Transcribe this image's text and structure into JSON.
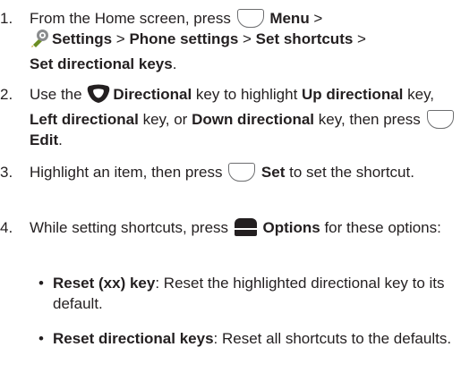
{
  "steps": [
    {
      "number": "1.",
      "parts": {
        "a": "From the Home screen, press ",
        "menu": "Menu",
        "gt1": " > ",
        "settings": "Settings",
        "gt2": " > ",
        "phone_settings": "Phone settings",
        "gt3": " > ",
        "set_shortcuts": "Set shortcuts",
        "gt4": " > ",
        "set_directional_keys": "Set directional keys",
        "end": "."
      }
    },
    {
      "number": "2.",
      "parts": {
        "a": "Use the ",
        "directional": "Directional",
        "b": " key to highlight ",
        "up": "Up directional",
        "c": " key, ",
        "left": "Left directional",
        "d": " key, or ",
        "down": "Down directional",
        "e": " key, then press ",
        "edit": "Edit",
        "end": "."
      }
    },
    {
      "number": "3.",
      "parts": {
        "a": "Highlight an item, then press ",
        "set": "Set",
        "b": " to set the shortcut."
      }
    },
    {
      "number": "4.",
      "parts": {
        "a": "While setting shortcuts, press ",
        "options": "Options",
        "b": " for these options:"
      }
    }
  ],
  "bullets": [
    {
      "marker": "•",
      "term": "Reset (xx) key",
      "desc": ": Reset the highlighted directional key to its default."
    },
    {
      "marker": "•",
      "term": "Reset directional keys",
      "desc": ": Reset all shortcuts to the defaults."
    }
  ],
  "icons": {
    "soft_key": "soft-key-icon",
    "settings": "settings-icon",
    "directional": "directional-key-icon",
    "options": "options-key-icon"
  }
}
